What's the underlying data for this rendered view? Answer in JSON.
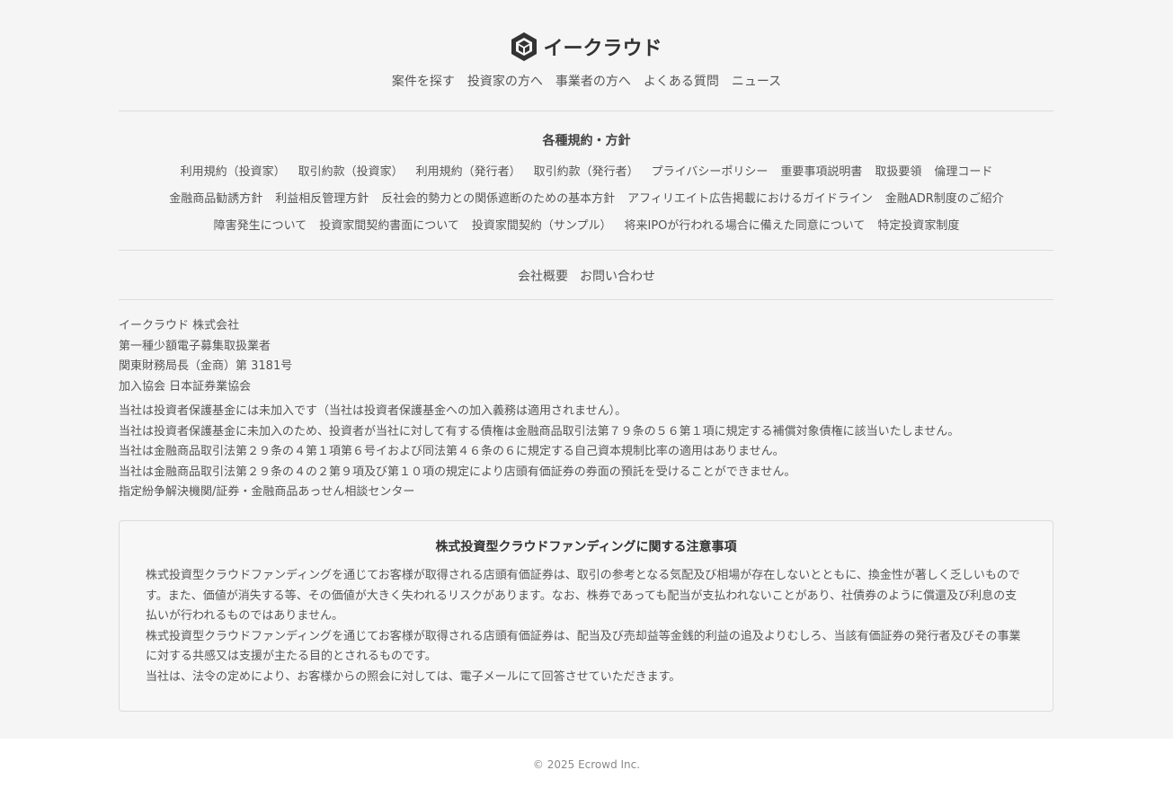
{
  "brand": {
    "name": "イークラウド"
  },
  "main_nav": [
    "案件を探す",
    "投資家の方へ",
    "事業者の方へ",
    "よくある質問",
    "ニュース"
  ],
  "policies": {
    "title": "各種規約・方針",
    "row1": [
      "利用規約（投資家）",
      "取引約款（投資家）",
      "利用規約（発行者）",
      "取引約款（発行者）",
      "プライバシーポリシー",
      "重要事項説明書",
      "取扱要領",
      "倫理コード"
    ],
    "row2": [
      "金融商品勧誘方針",
      "利益相反管理方針",
      "反社会的勢力との関係遮断のための基本方針",
      "アフィリエイト広告掲載におけるガイドライン",
      "金融ADR制度のご紹介"
    ],
    "row3": [
      "障害発生について",
      "投資家間契約書面について",
      "投資家間契約（サンプル）",
      "将来IPOが行われる場合に備えた同意について",
      "特定投資家制度"
    ]
  },
  "company_nav": [
    "会社概要",
    "お問い合わせ"
  ],
  "company_info": [
    "イークラウド 株式会社",
    "第一種少額電子募集取扱業者",
    "関東財務局長（金商）第 3181号",
    "加入協会 日本証券業協会"
  ],
  "disclosures": [
    "当社は投資者保護基金には未加入です（当社は投資者保護基金への加入義務は適用されません）。",
    "当社は投資者保護基金に未加入のため、投資者が当社に対して有する債権は金融商品取引法第７９条の５６第１項に規定する補償対象債権に該当いたしません。",
    "当社は金融商品取引法第２９条の４第１項第６号イおよび同法第４６条の６に規定する自己資本規制比率の適用はありません。",
    "当社は金融商品取引法第２９条の４の２第９項及び第１０項の規定により店頭有価証券の券面の預託を受けることができません。",
    "指定紛争解決機関/証券・金融商品あっせん相談センター"
  ],
  "notice": {
    "title": "株式投資型クラウドファンディングに関する注意事項",
    "paragraphs": [
      "株式投資型クラウドファンディングを通じてお客様が取得される店頭有価証券は、取引の参考となる気配及び相場が存在しないとともに、換金性が著しく乏しいものです。また、価値が消失する等、その価値が大きく失われるリスクがあります。なお、株券であっても配当が支払われないことがあり、社債券のように償還及び利息の支払いが行われるものではありません。",
      "株式投資型クラウドファンディングを通じてお客様が取得される店頭有価証券は、配当及び売却益等金銭的利益の追及よりむしろ、当該有価証券の発行者及びその事業に対する共感又は支援が主たる目的とされるものです。",
      "当社は、法令の定めにより、お客様からの照会に対しては、電子メールにて回答させていただきます。"
    ]
  },
  "footer": {
    "copyright": "© 2025 Ecrowd Inc."
  }
}
